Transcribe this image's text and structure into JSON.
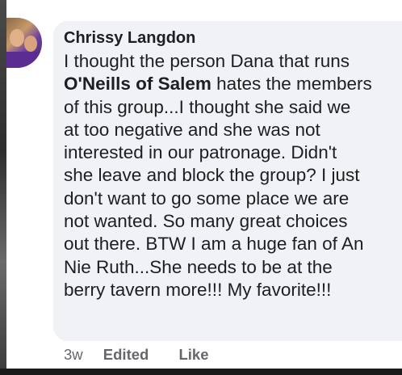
{
  "comment": {
    "author": "Chrissy Langdon",
    "line1": "I thought the person Dana that runs",
    "mention": "O'Neills of Salem",
    "line2_rest": " hates the members",
    "line3": "of this group...I thought she said we",
    "line4": "at too negative and she was not",
    "line5": "interested in our patronage. Didn't",
    "line6": "she leave and block the group? I just",
    "line7": "don't want to go some place we are",
    "line8": "not wanted. So many great choices",
    "line9": "out there. BTW I am a huge fan of An",
    "line10": "Nie Ruth...She needs to be at the",
    "line11": "berry tavern more!!! My favorite!!!"
  },
  "actions": {
    "time": "3w",
    "edited": "Edited",
    "like": "Like"
  },
  "colors": {
    "bubble": "#f0f2f5",
    "text": "#1c1e21",
    "meta": "#65676b"
  }
}
